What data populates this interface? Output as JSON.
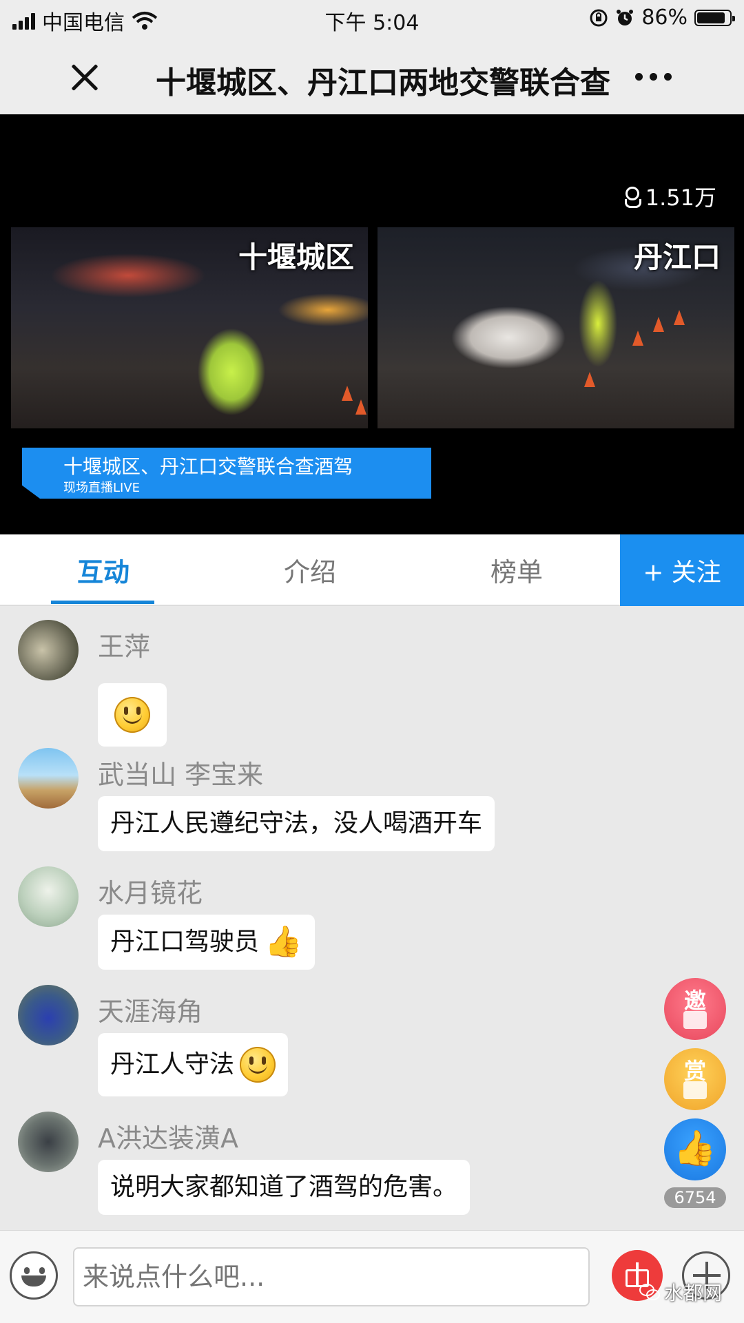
{
  "status_bar": {
    "carrier": "中国电信",
    "time": "下午 5:04",
    "battery_percent": "86%",
    "battery_level": 0.86
  },
  "title_bar": {
    "title": "十堰城区、丹江口两地交警联合查",
    "close_icon": "close-icon",
    "more_icon": "more-icon"
  },
  "video": {
    "viewer_count": "1.51万",
    "left_label": "十堰城区",
    "right_label": "丹江口",
    "banner_title": "十堰城区、丹江口交警联合查酒驾",
    "banner_sub": "现场直播LIVE"
  },
  "tabs": [
    {
      "label": "互动",
      "active": true
    },
    {
      "label": "介绍",
      "active": false
    },
    {
      "label": "榜单",
      "active": false
    }
  ],
  "follow_label": "+ 关注",
  "messages": [
    {
      "user": "王萍",
      "text": "",
      "emoji": "smiley"
    },
    {
      "user": "武当山 李宝来",
      "text": "丹江人民遵纪守法，没人喝酒开车",
      "emoji": ""
    },
    {
      "user": "水月镜花",
      "text": "丹江口驾驶员",
      "emoji": "thumbs-up"
    },
    {
      "user": "天涯海角",
      "text": "丹江人守法",
      "emoji": "smiley"
    },
    {
      "user": "A洪达装潢A",
      "text": "说明大家都知道了酒驾的危害。",
      "emoji": ""
    }
  ],
  "actions": {
    "invite_label": "邀",
    "reward_label": "赏",
    "like_count": "6754"
  },
  "input": {
    "placeholder": "来说点什么吧..."
  },
  "watermark": "水都网",
  "colors": {
    "accent": "#1585d8",
    "follow_bg": "#1b8ff0",
    "banner_bg": "#1c8ef0"
  }
}
